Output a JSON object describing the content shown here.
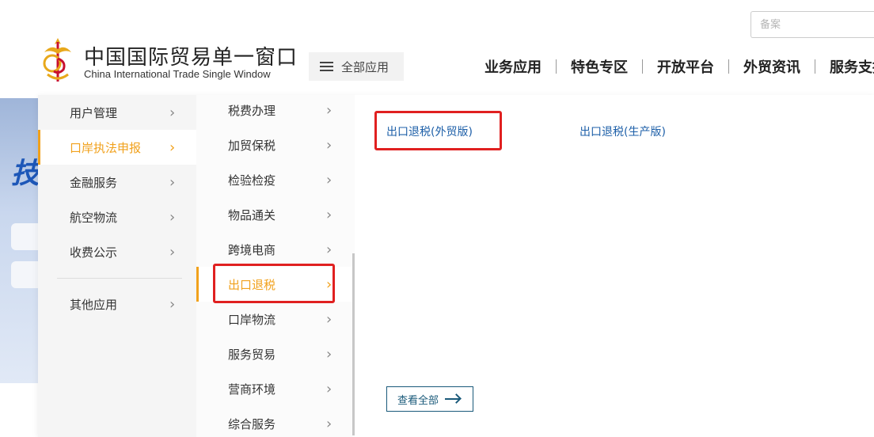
{
  "header": {
    "logo_cn": "中国国际贸易单一窗口",
    "logo_en": "China International Trade Single Window",
    "search_placeholder": "备案",
    "all_apps_label": "全部应用",
    "nav": [
      "业务应用",
      "特色专区",
      "开放平台",
      "外贸资讯",
      "服务支持"
    ]
  },
  "banner": {
    "partial_char": "技"
  },
  "menu": {
    "level1": [
      {
        "label": "用户管理",
        "active": false
      },
      {
        "label": "口岸执法申报",
        "active": true
      },
      {
        "label": "金融服务",
        "active": false
      },
      {
        "label": "航空物流",
        "active": false
      },
      {
        "label": "收费公示",
        "active": false
      },
      {
        "label": "其他应用",
        "active": false
      }
    ],
    "level2": [
      {
        "label": "税费办理",
        "active": false
      },
      {
        "label": "加贸保税",
        "active": false
      },
      {
        "label": "检验检疫",
        "active": false
      },
      {
        "label": "物品通关",
        "active": false
      },
      {
        "label": "跨境电商",
        "active": false
      },
      {
        "label": "出口退税",
        "active": true
      },
      {
        "label": "口岸物流",
        "active": false
      },
      {
        "label": "服务贸易",
        "active": false
      },
      {
        "label": "营商环境",
        "active": false
      },
      {
        "label": "综合服务",
        "active": false
      }
    ],
    "chevron": "›",
    "level3": [
      "出口退税(外贸版)",
      "出口退税(生产版)"
    ],
    "view_all_label": "查看全部"
  },
  "colors": {
    "accent": "#f1a11c",
    "link": "#1d5fa8",
    "highlight_box": "#e02020"
  }
}
